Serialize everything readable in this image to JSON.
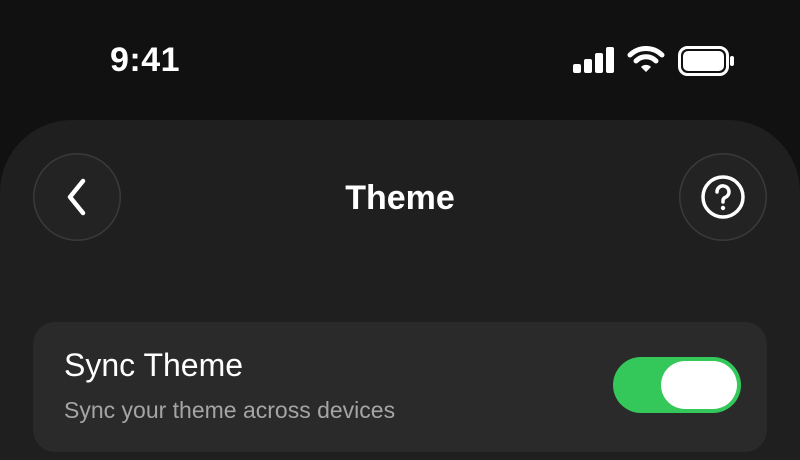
{
  "status_bar": {
    "time": "9:41",
    "icons": [
      "signal-icon",
      "wifi-icon",
      "battery-icon"
    ]
  },
  "nav": {
    "title": "Theme",
    "back_icon": "chevron-left-icon",
    "help_icon": "question-circle-icon"
  },
  "settings": {
    "sync_theme": {
      "label": "Sync Theme",
      "description": "Sync your theme across devices",
      "enabled": true
    }
  },
  "colors": {
    "background": "#111111",
    "sheet": "#1f1f1f",
    "card": "#2a2a2a",
    "toggle_on": "#34c759",
    "secondary_text": "#a5a5a5"
  }
}
